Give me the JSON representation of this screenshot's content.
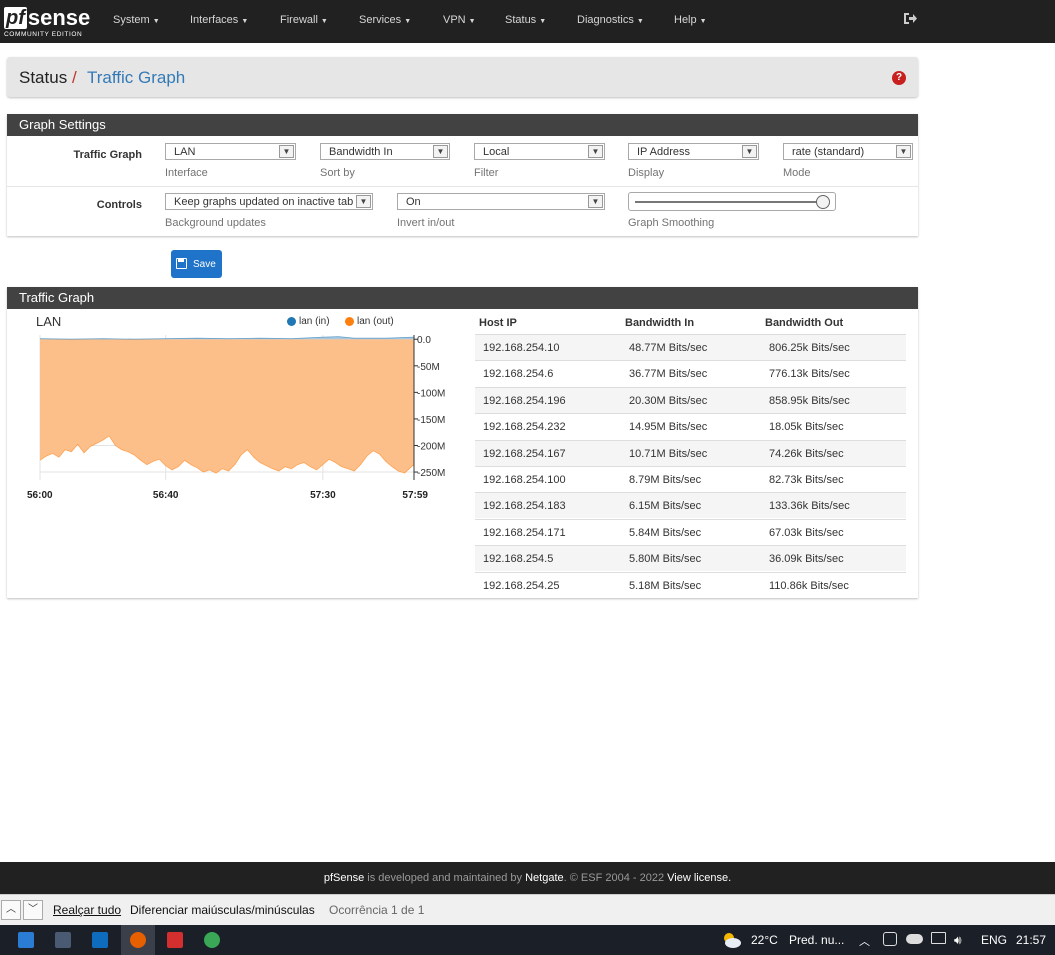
{
  "nav": {
    "logo_pf": "pf",
    "logo_sense": "sense",
    "logo_edition": "COMMUNITY EDITION",
    "items": [
      "System",
      "Interfaces",
      "Firewall",
      "Services",
      "VPN",
      "Status",
      "Diagnostics",
      "Help"
    ]
  },
  "breadcrumb": {
    "section": "Status",
    "separator": "/",
    "page": "Traffic Graph",
    "help_icon": "?"
  },
  "settings": {
    "title": "Graph Settings",
    "traffic_graph_label": "Traffic Graph",
    "controls_label": "Controls",
    "interface": {
      "value": "LAN",
      "help": "Interface"
    },
    "sort_by": {
      "value": "Bandwidth In",
      "help": "Sort by"
    },
    "filter": {
      "value": "Local",
      "help": "Filter"
    },
    "display": {
      "value": "IP Address",
      "help": "Display"
    },
    "mode": {
      "value": "rate (standard)",
      "help": "Mode"
    },
    "background_updates": {
      "value": "Keep graphs updated on inactive tab",
      "help": "Background updates"
    },
    "invert": {
      "value": "On",
      "help": "Invert in/out"
    },
    "smoothing": {
      "help": "Graph Smoothing",
      "level": 0.95
    },
    "save_label": "Save"
  },
  "traffic": {
    "title": "Traffic Graph",
    "columns": [
      "Host IP",
      "Bandwidth In",
      "Bandwidth Out"
    ],
    "rows": [
      [
        "192.168.254.10",
        "48.77M Bits/sec",
        "806.25k Bits/sec"
      ],
      [
        "192.168.254.6",
        "36.77M Bits/sec",
        "776.13k Bits/sec"
      ],
      [
        "192.168.254.196",
        "20.30M Bits/sec",
        "858.95k Bits/sec"
      ],
      [
        "192.168.254.232",
        "14.95M Bits/sec",
        "18.05k Bits/sec"
      ],
      [
        "192.168.254.167",
        "10.71M Bits/sec",
        "74.26k Bits/sec"
      ],
      [
        "192.168.254.100",
        "8.79M Bits/sec",
        "82.73k Bits/sec"
      ],
      [
        "192.168.254.183",
        "6.15M Bits/sec",
        "133.36k Bits/sec"
      ],
      [
        "192.168.254.171",
        "5.84M Bits/sec",
        "67.03k Bits/sec"
      ],
      [
        "192.168.254.5",
        "5.80M Bits/sec",
        "36.09k Bits/sec"
      ],
      [
        "192.168.254.25",
        "5.18M Bits/sec",
        "110.86k Bits/sec"
      ]
    ]
  },
  "chart_data": {
    "type": "area",
    "title": "LAN",
    "legend_position": "top-right",
    "x_ticks": [
      "56:00",
      "56:40",
      "57:30",
      "57:59"
    ],
    "x_tick_seconds": [
      0,
      40,
      90,
      119
    ],
    "y_ticks": [
      "0.0",
      "-50M",
      "-100M",
      "-150M",
      "-200M",
      "-250M"
    ],
    "y_tick_values": [
      0,
      -50,
      -100,
      -150,
      -200,
      -250
    ],
    "ylim": [
      -265,
      8
    ],
    "xlim": [
      0,
      119
    ],
    "grid": true,
    "series": [
      {
        "name": "lan (in)",
        "color": "#1f77b4",
        "fill": "#a9c8e0",
        "x": [
          0,
          10,
          20,
          30,
          40,
          50,
          60,
          70,
          80,
          90,
          95,
          100,
          110,
          119
        ],
        "values": [
          1,
          0,
          1,
          0,
          1,
          2,
          1,
          2,
          1,
          4,
          5,
          2,
          2,
          4
        ]
      },
      {
        "name": "lan (out)",
        "color": "#ff7f0e",
        "fill": "#fdbf8a",
        "x": [
          0,
          2,
          4,
          6,
          8,
          10,
          12,
          14,
          16,
          18,
          20,
          22,
          24,
          26,
          28,
          30,
          32,
          34,
          36,
          38,
          40,
          42,
          44,
          46,
          48,
          50,
          52,
          54,
          56,
          58,
          60,
          62,
          64,
          66,
          68,
          70,
          72,
          74,
          76,
          78,
          80,
          82,
          84,
          86,
          88,
          90,
          92,
          94,
          96,
          98,
          100,
          102,
          104,
          106,
          108,
          110,
          112,
          114,
          116,
          119
        ],
        "values": [
          -228,
          -220,
          -215,
          -222,
          -208,
          -212,
          -198,
          -214,
          -202,
          -196,
          -190,
          -182,
          -200,
          -208,
          -212,
          -218,
          -228,
          -236,
          -230,
          -226,
          -238,
          -246,
          -240,
          -228,
          -236,
          -242,
          -250,
          -246,
          -252,
          -244,
          -248,
          -236,
          -218,
          -208,
          -222,
          -232,
          -238,
          -244,
          -248,
          -240,
          -244,
          -236,
          -232,
          -240,
          -246,
          -236,
          -226,
          -232,
          -240,
          -244,
          -248,
          -236,
          -220,
          -210,
          -216,
          -230,
          -240,
          -248,
          -252,
          -236
        ]
      }
    ]
  },
  "footer": {
    "pre": "pfSense",
    "mid1": " is developed and maintained by ",
    "company": "Netgate",
    "mid2": ". © ESF 2004 - 2022 ",
    "license": "View license."
  },
  "findbar": {
    "highlight_all": "Realçar tudo",
    "match_case": "Diferenciar maiúsculas/minúsculas",
    "status": "Ocorrência 1 de 1"
  },
  "taskbar": {
    "temperature": "22°C",
    "weather": "Pred. nu...",
    "language": "ENG",
    "time": "21:57"
  }
}
